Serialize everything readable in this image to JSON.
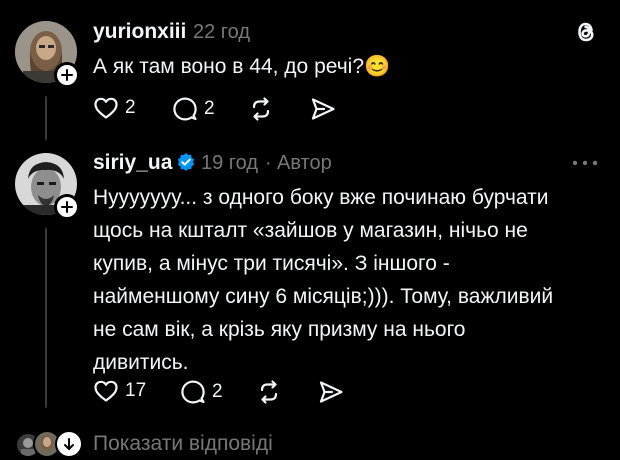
{
  "colors": {
    "background": "#000000",
    "text_primary": "#f3f5f7",
    "text_secondary": "#777777",
    "verified_badge": "#0095f6",
    "thread_line": "#3a3a3a"
  },
  "posts": [
    {
      "username": "yurionxiii",
      "time": "22 год",
      "author_tag": "",
      "verified": false,
      "text_lines": [
        "А як там воно в 44, до речі?😊"
      ],
      "actions": {
        "like_count": "2",
        "comment_count": "2"
      }
    },
    {
      "username": "siriy_ua",
      "time": "19 год",
      "separator": "·",
      "author_tag": "Автор",
      "verified": true,
      "text_lines": [
        "Нууууууу... з одного боку вже починаю бурчати",
        "щось на кшталт «зайшов у магазин, нічьо не",
        "купив, а мінус три тисячі». З іншого -",
        "наймeншому сину 6 місяців;))). Тому, важливий",
        "не сам вік, а крізь яку призму на нього",
        "дивитись."
      ],
      "actions": {
        "like_count": "17",
        "comment_count": "2"
      }
    }
  ],
  "show_replies_label": "Показати відповіді",
  "icons": {
    "app_logo": "threads-logo-icon",
    "more": "more-horizontal-icon",
    "like": "heart-icon",
    "comment": "comment-bubble-icon",
    "repost": "repost-icon",
    "share": "send-icon"
  }
}
